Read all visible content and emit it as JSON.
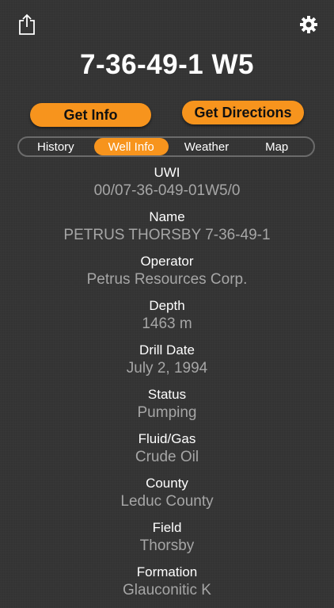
{
  "header": {
    "share_icon": "share-icon",
    "settings_icon": "gear-icon",
    "title": "7-36-49-1 W5"
  },
  "actions": {
    "get_info": "Get Info",
    "get_directions": "Get Directions"
  },
  "tabs": [
    {
      "label": "History",
      "active": false
    },
    {
      "label": "Well Info",
      "active": true
    },
    {
      "label": "Weather",
      "active": false
    },
    {
      "label": "Map",
      "active": false
    }
  ],
  "well_info": [
    {
      "label": "UWI",
      "value": "00/07-36-049-01W5/0"
    },
    {
      "label": "Name",
      "value": "PETRUS THORSBY 7-36-49-1"
    },
    {
      "label": "Operator",
      "value": "Petrus Resources Corp."
    },
    {
      "label": "Depth",
      "value": "1463 m"
    },
    {
      "label": "Drill Date",
      "value": "July 2, 1994"
    },
    {
      "label": "Status",
      "value": "Pumping"
    },
    {
      "label": "Fluid/Gas",
      "value": "Crude Oil"
    },
    {
      "label": "County",
      "value": "Leduc County"
    },
    {
      "label": "Field",
      "value": "Thorsby"
    },
    {
      "label": "Formation",
      "value": "Glauconitic K"
    }
  ],
  "colors": {
    "accent": "#f7941d",
    "background": "#333333",
    "value_text": "#a6a6a6"
  }
}
